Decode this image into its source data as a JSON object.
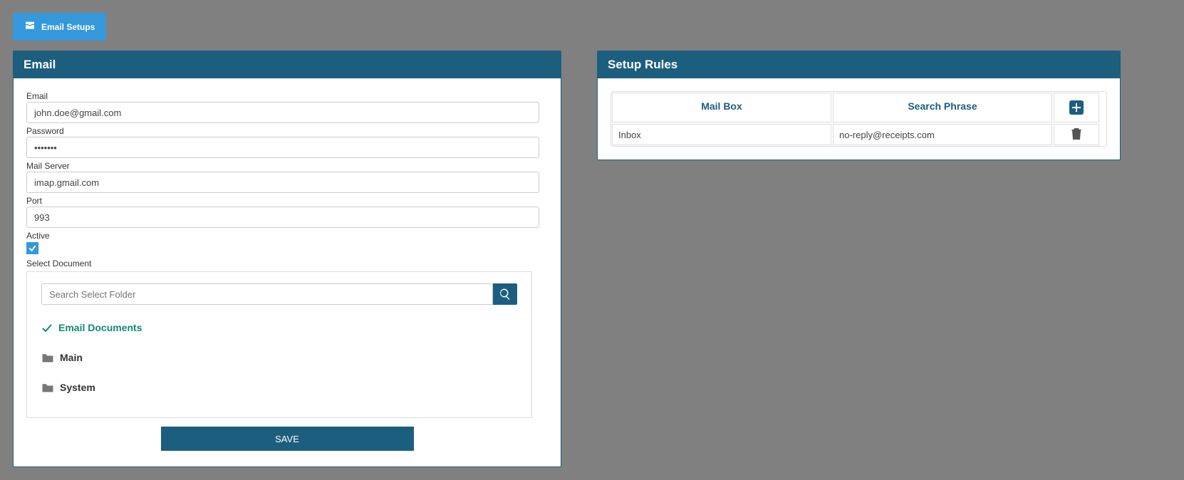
{
  "top_button": {
    "label": "Email Setups"
  },
  "email_panel": {
    "title": "Email",
    "fields": {
      "email_label": "Email",
      "email_value": "john.doe@gmail.com",
      "password_label": "Password",
      "password_value": "•••••••",
      "mailserver_label": "Mail Server",
      "mailserver_value": "imap.gmail.com",
      "port_label": "Port",
      "port_value": "993",
      "active_label": "Active",
      "select_doc_label": "Select Document"
    },
    "search_placeholder": "Search Select Folder",
    "tree": {
      "selected_label": "Email Documents",
      "folder1_label": "Main",
      "folder2_label": "System"
    },
    "save_label": "SAVE"
  },
  "rules_panel": {
    "title": "Setup Rules",
    "headers": {
      "mailbox": "Mail Box",
      "phrase": "Search Phrase"
    },
    "rows": [
      {
        "mailbox": "Inbox",
        "phrase": "no-reply@receipts.com"
      }
    ]
  }
}
